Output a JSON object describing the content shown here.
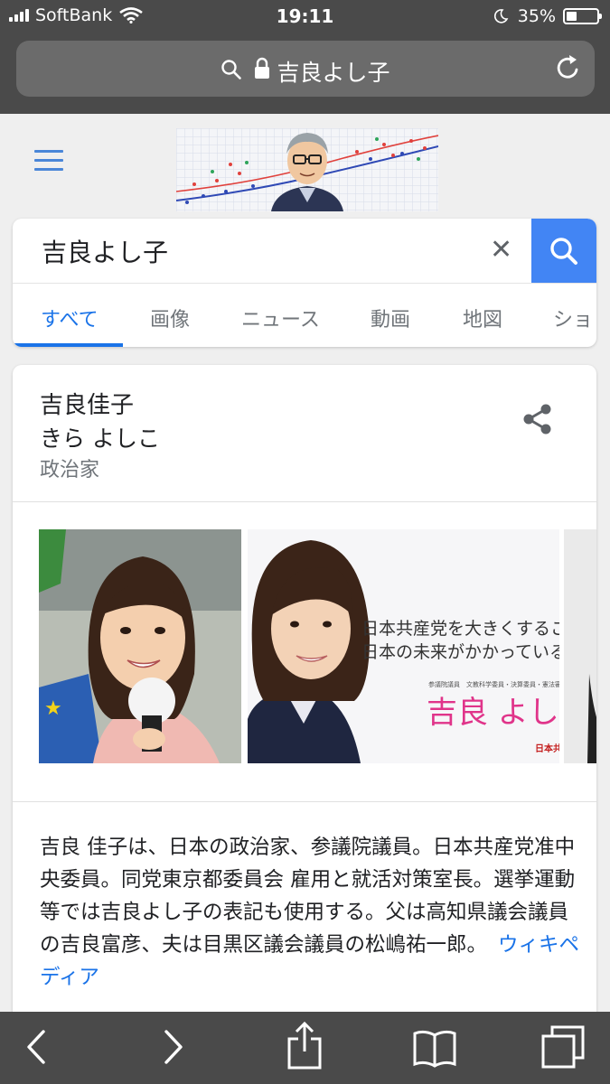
{
  "status_bar": {
    "carrier": "SoftBank",
    "time": "19:11",
    "battery": "35%"
  },
  "url_bar": {
    "text": "吉良よし子"
  },
  "search": {
    "query": "吉良よし子",
    "clear_label": "✕",
    "tabs": [
      {
        "label": "すべて",
        "active": true
      },
      {
        "label": "画像"
      },
      {
        "label": "ニュース"
      },
      {
        "label": "動画"
      },
      {
        "label": "地図"
      },
      {
        "label": "ショ"
      }
    ]
  },
  "knowledge_panel": {
    "name": "吉良佳子",
    "reading": "きら よしこ",
    "description": "政治家",
    "photo2_text": {
      "line1": "日本共産党を大きくすること",
      "line2": "日本の未来がかかっている。",
      "small": "参議院議員　文教科学委員・決算委員・憲法審",
      "name": "吉良 よし子",
      "party": "日本共"
    },
    "summary": "吉良 佳子は、日本の政治家、参議院議員。日本共産党准中央委員。同党東京都委員会 雇用と就活対策室長。選挙運動等では吉良よし子の表記も使用する。父は高知県議会議員の吉良富彦、夫は目黒区議会議員の松嶋祐一郎。",
    "source_link": "ウィキペディア"
  },
  "colors": {
    "accent": "#1a73e8",
    "search_button": "#4285f4",
    "chrome": "#4a4a4a"
  },
  "icons": {
    "back": "chevron-left-icon",
    "forward": "chevron-right-icon",
    "share": "share-icon",
    "bookmarks": "book-icon",
    "tabs": "tabs-icon"
  }
}
